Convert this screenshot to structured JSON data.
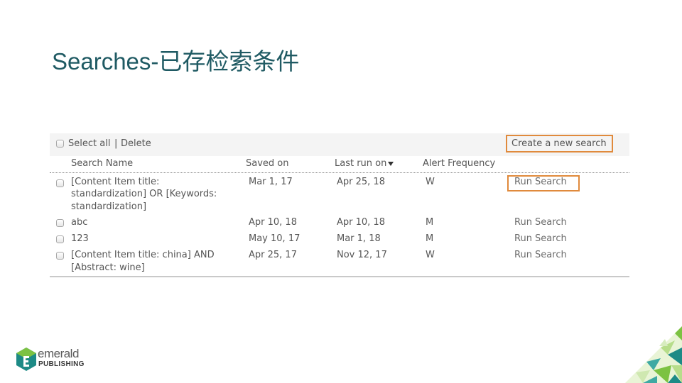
{
  "slide": {
    "title": "Searches-已存检索条件"
  },
  "toolbar": {
    "select_all": "Select all",
    "separator": "|",
    "delete": "Delete",
    "create_new_search": "Create a new search"
  },
  "columns": {
    "search_name": "Search Name",
    "saved_on": "Saved on",
    "last_run_on": "Last run on",
    "alert_frequency": "Alert Frequency"
  },
  "rows": [
    {
      "name_lines": [
        "[Content Item title:",
        "standardization] OR [Keywords:",
        "standardization]"
      ],
      "saved_on": "Mar 1, 17",
      "last_run_on": "Apr 25, 18",
      "alert": "W",
      "action": "Run Search"
    },
    {
      "name_lines": [
        "abc"
      ],
      "saved_on": "Apr 10, 18",
      "last_run_on": "Apr 10, 18",
      "alert": "M",
      "action": "Run Search"
    },
    {
      "name_lines": [
        "123"
      ],
      "saved_on": "May 10, 17",
      "last_run_on": "Mar 1, 18",
      "alert": "M",
      "action": "Run Search"
    },
    {
      "name_lines": [
        "[Content Item title: china] AND",
        "[Abstract: wine]"
      ],
      "saved_on": "Apr 25, 17",
      "last_run_on": "Nov 12, 17",
      "alert": "W",
      "action": "Run Search"
    }
  ],
  "logo": {
    "line1": "emerald",
    "line2": "PUBLISHING"
  },
  "colors": {
    "title": "#1f5a63",
    "highlight": "#e08a3c",
    "logo_teal": "#1d8a86",
    "logo_green": "#7cc242"
  }
}
